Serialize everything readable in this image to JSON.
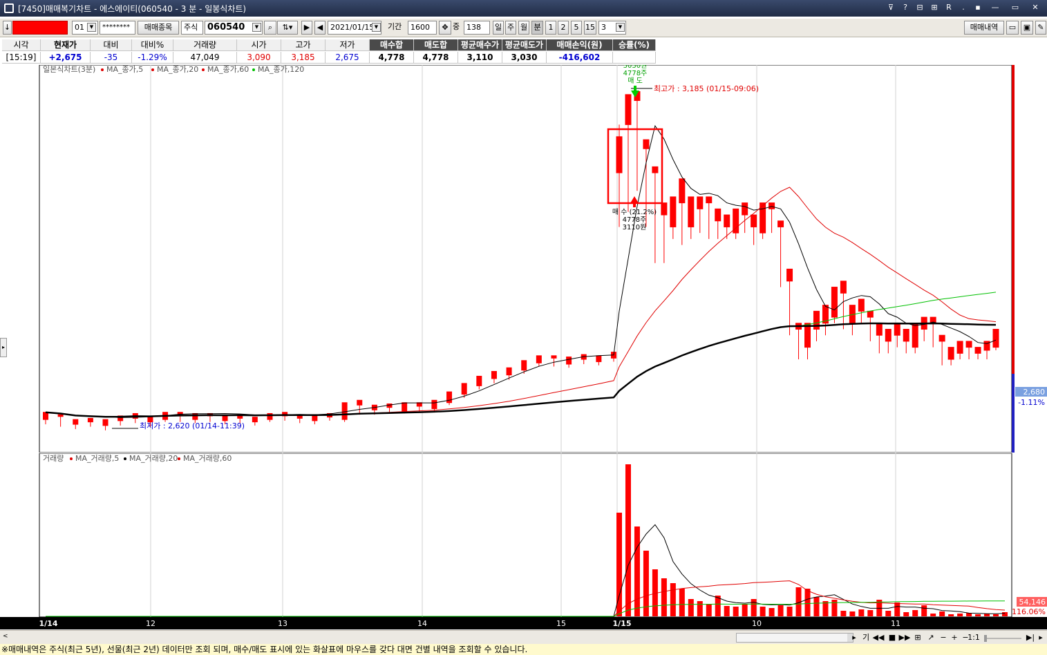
{
  "window": {
    "title": "[7450]매매복기차트 - 에스에이티(060540 - 3 분 - 일봉식차트)"
  },
  "toolbar": {
    "account_suffix": "01",
    "password_mask": "********",
    "trade_item_button": "매매종목",
    "market_type": "주식",
    "stock_code": "060540",
    "date": "2021/01/15",
    "period_label": "기간",
    "period_value": "1600",
    "count_label": "중",
    "count_value": "138",
    "interval_buttons": [
      "일",
      "주",
      "월",
      "분",
      "1",
      "2",
      "5",
      "15"
    ],
    "interval_selected": "분",
    "minute_value": "3",
    "trade_history_button": "매매내역"
  },
  "quote": {
    "headers": [
      "시각",
      "현재가",
      "대비",
      "대비%",
      "거래량",
      "시가",
      "고가",
      "저가",
      "매수합",
      "매도합",
      "평균매수가",
      "평균매도가",
      "매매손익(원)",
      "승률(%)"
    ],
    "values": [
      "[15:19]",
      "+2,675",
      "-35",
      "-1.29%",
      "47,049",
      "3,090",
      "3,185",
      "2,675",
      "4,778",
      "4,778",
      "3,110",
      "3,030",
      "-416,602",
      ""
    ]
  },
  "price_chart": {
    "legend_title": "일본식차트(3분)",
    "legend_items": [
      "MA_종가,5",
      "MA_종가,20",
      "MA_종가,60",
      "MA_종가,120"
    ],
    "high_label": "최고가 : 3,185 (01/15-09:06)",
    "low_label": "최저가 : 2,620 (01/14-11:39)",
    "sell_marker_lines": [
      "3030원",
      "4778주",
      "매 도"
    ],
    "buy_marker_lines": [
      "매 수 (21.2%)",
      "4778주",
      "3110원"
    ],
    "current_price": "2,680",
    "current_change": "-1.11%"
  },
  "volume_chart": {
    "legend_title": "거래량",
    "legend_items": [
      "MA_거래량,5",
      "MA_거래량,20",
      "MA_거래량,60"
    ],
    "current_value": "54,146",
    "current_pct": "116.06%"
  },
  "date_axis": {
    "labels": [
      "1/14",
      "12",
      "13",
      "14",
      "15",
      "1/15",
      "10",
      "11"
    ]
  },
  "navbar": {
    "period_label": "기",
    "ratio_label": "1:1"
  },
  "status": {
    "message": "※매매내역은 주식(최근 5년), 선물(최근 2년) 데이터만 조회 되며, 매수/매도 표시에 있는 화살표에 마우스를 갖다 대면 건별 내역을 조회할 수 있습니다."
  },
  "colors": {
    "up": "#ff0000",
    "down": "#0000ff",
    "ma5": "#000000",
    "ma20": "#e00000",
    "ma60": "#00c000",
    "ma120": "#000000"
  },
  "chart_data": [
    {
      "type": "candlestick",
      "title": "일본식차트(3분)",
      "ylim": [
        2600,
        3220
      ],
      "x_labels": [
        "1/14",
        "12",
        "13",
        "14",
        "15",
        "1/15",
        "10",
        "11"
      ],
      "ohlc": [
        [
          2640,
          2652,
          2632,
          2645
        ],
        [
          2645,
          2648,
          2628,
          2632
        ],
        [
          2632,
          2640,
          2624,
          2636
        ],
        [
          2636,
          2642,
          2628,
          2630
        ],
        [
          2630,
          2640,
          2622,
          2638
        ],
        [
          2638,
          2646,
          2630,
          2642
        ],
        [
          2642,
          2650,
          2634,
          2636
        ],
        [
          2636,
          2644,
          2628,
          2640
        ],
        [
          2640,
          2652,
          2636,
          2648
        ],
        [
          2648,
          2652,
          2636,
          2640
        ],
        [
          2640,
          2650,
          2634,
          2646
        ],
        [
          2646,
          2650,
          2636,
          2638
        ],
        [
          2638,
          2646,
          2632,
          2642
        ],
        [
          2642,
          2648,
          2634,
          2636
        ],
        [
          2636,
          2644,
          2630,
          2640
        ],
        [
          2640,
          2650,
          2636,
          2646
        ],
        [
          2646,
          2652,
          2638,
          2642
        ],
        [
          2642,
          2648,
          2634,
          2638
        ],
        [
          2638,
          2646,
          2632,
          2644
        ],
        [
          2644,
          2650,
          2638,
          2640
        ],
        [
          2640,
          2668,
          2636,
          2664
        ],
        [
          2664,
          2672,
          2648,
          2656
        ],
        [
          2656,
          2664,
          2648,
          2660
        ],
        [
          2660,
          2666,
          2650,
          2654
        ],
        [
          2654,
          2668,
          2650,
          2662
        ],
        [
          2662,
          2668,
          2652,
          2658
        ],
        [
          2658,
          2672,
          2654,
          2668
        ],
        [
          2668,
          2686,
          2664,
          2682
        ],
        [
          2682,
          2700,
          2676,
          2696
        ],
        [
          2696,
          2712,
          2690,
          2708
        ],
        [
          2708,
          2720,
          2700,
          2714
        ],
        [
          2714,
          2726,
          2706,
          2722
        ],
        [
          2722,
          2738,
          2716,
          2734
        ],
        [
          2734,
          2746,
          2728,
          2742
        ],
        [
          2742,
          2746,
          2728,
          2732
        ],
        [
          2732,
          2744,
          2726,
          2740
        ],
        [
          2740,
          2748,
          2732,
          2736
        ],
        [
          2736,
          2746,
          2730,
          2742
        ],
        [
          2742,
          2752,
          2736,
          2748
        ],
        [
          3050,
          3110,
          2960,
          3130
        ],
        [
          3130,
          3180,
          2985,
          3000
        ],
        [
          3170,
          3185,
          3020,
          3090
        ],
        [
          3090,
          3105,
          2960,
          3050
        ],
        [
          3050,
          3060,
          2900,
          2900
        ],
        [
          2980,
          3000,
          2900,
          2960
        ],
        [
          2960,
          3010,
          2940,
          3000
        ],
        [
          3000,
          3040,
          2930,
          2960
        ],
        [
          2960,
          3010,
          2940,
          2990
        ],
        [
          2990,
          3010,
          2950,
          3000
        ],
        [
          3000,
          3010,
          2940,
          2970
        ],
        [
          2970,
          2990,
          2940,
          2960
        ],
        [
          2960,
          2980,
          2940,
          2950
        ],
        [
          2950,
          2990,
          2940,
          2980
        ],
        [
          2980,
          3000,
          2950,
          2960
        ],
        [
          2960,
          2980,
          2930,
          2950
        ],
        [
          2950,
          3000,
          2940,
          2990
        ],
        [
          2990,
          3000,
          2950,
          2960
        ],
        [
          2960,
          2970,
          2860,
          2870
        ],
        [
          2870,
          2890,
          2780,
          2790
        ],
        [
          2790,
          2800,
          2740,
          2760
        ],
        [
          2760,
          2800,
          2740,
          2790
        ],
        [
          2790,
          2820,
          2770,
          2800
        ],
        [
          2800,
          2830,
          2780,
          2810
        ],
        [
          2810,
          2860,
          2800,
          2850
        ],
        [
          2850,
          2870,
          2790,
          2800
        ],
        [
          2800,
          2830,
          2780,
          2820
        ],
        [
          2820,
          2840,
          2800,
          2810
        ],
        [
          2810,
          2820,
          2770,
          2780
        ],
        [
          2780,
          2800,
          2750,
          2770
        ],
        [
          2770,
          2790,
          2750,
          2780
        ],
        [
          2780,
          2800,
          2760,
          2770
        ],
        [
          2770,
          2790,
          2750,
          2760
        ],
        [
          2760,
          2800,
          2750,
          2790
        ],
        [
          2790,
          2810,
          2770,
          2800
        ],
        [
          2800,
          2810,
          2760,
          2770
        ],
        [
          2770,
          2780,
          2730,
          2740
        ],
        [
          2740,
          2760,
          2730,
          2750
        ],
        [
          2750,
          2770,
          2740,
          2760
        ],
        [
          2760,
          2770,
          2740,
          2750
        ],
        [
          2750,
          2760,
          2740,
          2755
        ],
        [
          2755,
          2770,
          2740,
          2760
        ],
        [
          2760,
          2790,
          2755,
          2780
        ]
      ],
      "series": [
        {
          "name": "MA_종가,5"
        },
        {
          "name": "MA_종가,20"
        },
        {
          "name": "MA_종가,60"
        },
        {
          "name": "MA_종가,120"
        }
      ]
    },
    {
      "type": "bar",
      "title": "거래량",
      "ylim": [
        0,
        220000
      ],
      "values": [
        0,
        0,
        0,
        0,
        0,
        0,
        0,
        0,
        0,
        0,
        0,
        0,
        0,
        0,
        0,
        0,
        0,
        0,
        0,
        0,
        0,
        0,
        0,
        0,
        0,
        0,
        0,
        0,
        0,
        0,
        0,
        0,
        0,
        0,
        0,
        0,
        0,
        0,
        0,
        150000,
        220000,
        130000,
        95000,
        68000,
        55000,
        48000,
        40000,
        25000,
        22000,
        18000,
        30000,
        15000,
        14000,
        18000,
        25000,
        14000,
        12000,
        16000,
        14000,
        42000,
        40000,
        28000,
        22000,
        24000,
        8000,
        7000,
        10000,
        9000,
        24000,
        8000,
        20000,
        6000,
        9000,
        16000,
        4000,
        7000,
        3000,
        4000,
        5000,
        3000,
        4000,
        3000,
        6000
      ]
    }
  ]
}
